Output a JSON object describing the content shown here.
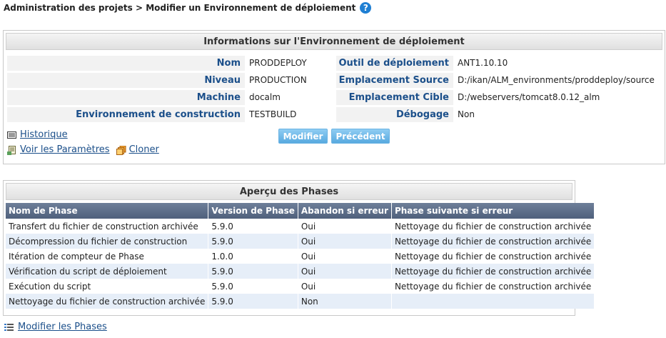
{
  "breadcrumb": {
    "text": "Administration des projets > Modifier un Environnement de déploiement",
    "help_icon": "question-circle"
  },
  "info_panel": {
    "title": "Informations sur l'Environnement de déploiement",
    "left_fields": [
      {
        "label": "Nom",
        "value": "PRODDEPLOY"
      },
      {
        "label": "Niveau",
        "value": "PRODUCTION"
      },
      {
        "label": "Machine",
        "value": "docalm"
      },
      {
        "label": "Environnement de construction",
        "value": "TESTBUILD"
      }
    ],
    "right_fields": [
      {
        "label": "Outil de déploiement",
        "value": "ANT1.10.10"
      },
      {
        "label": "Emplacement Source",
        "value": "D:/ikan/ALM_environments/proddeploy/source"
      },
      {
        "label": "Emplacement Cible",
        "value": "D:/webservers/tomcat8.0.12_alm"
      },
      {
        "label": "Débogage",
        "value": "Non"
      }
    ],
    "links": {
      "history": "Historique",
      "view_params": "Voir les Paramètres",
      "clone": "Cloner"
    },
    "buttons": {
      "modify": "Modifier",
      "previous": "Précédent"
    }
  },
  "phases_panel": {
    "title": "Aperçu des Phases",
    "columns": [
      "Nom de Phase",
      "Version de Phase",
      "Abandon si erreur",
      "Phase suivante si erreur"
    ],
    "rows": [
      [
        "Transfert du fichier de construction archivée",
        "5.9.0",
        "Oui",
        "Nettoyage du fichier de construction archivée"
      ],
      [
        "Décompression du fichier de construction",
        "5.9.0",
        "Oui",
        "Nettoyage du fichier de construction archivée"
      ],
      [
        "Itération de compteur de Phase",
        "1.0.0",
        "Oui",
        "Nettoyage du fichier de construction archivée"
      ],
      [
        "Vérification du script de déploiement",
        "5.9.0",
        "Oui",
        "Nettoyage du fichier de construction archivée"
      ],
      [
        "Exécution du script",
        "5.9.0",
        "Oui",
        "Nettoyage du fichier de construction archivée"
      ],
      [
        "Nettoyage du fichier de construction archivée",
        "5.9.0",
        "Non",
        ""
      ]
    ],
    "modify_link": "Modifier les Phases"
  },
  "colors": {
    "label_blue": "#1b4f8a",
    "button_blue": "#58a9e0",
    "header_slate": "#4f607c",
    "row_alt": "#e6eef8"
  }
}
